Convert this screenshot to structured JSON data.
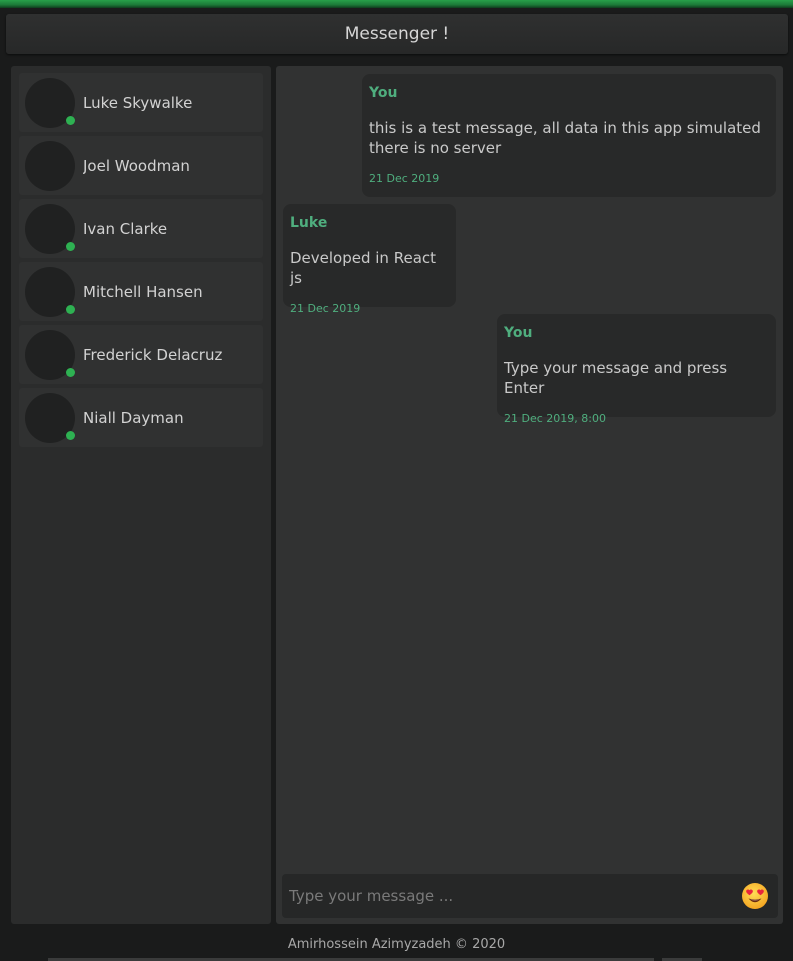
{
  "header": {
    "title": "Messenger !"
  },
  "contacts": [
    {
      "name": "Luke Skywalke",
      "online": true
    },
    {
      "name": "Joel Woodman",
      "online": false
    },
    {
      "name": "Ivan Clarke",
      "online": true
    },
    {
      "name": "Mitchell Hansen",
      "online": true
    },
    {
      "name": "Frederick Delacruz",
      "online": true
    },
    {
      "name": "Niall Dayman",
      "online": true
    }
  ],
  "messages": [
    {
      "author": "You",
      "text": "this is a test message, all data in this app simulated there is no server",
      "time": "21 Dec 2019"
    },
    {
      "author": "Luke",
      "text": "Developed in React js",
      "time": "21 Dec 2019"
    },
    {
      "author": "You",
      "text": "Type your message and press Enter",
      "time": "21 Dec 2019, 8:00"
    }
  ],
  "composer": {
    "placeholder": "Type your message ...",
    "value": ""
  },
  "footer": {
    "text": "Amirhossein Azimyzadeh © 2020"
  },
  "colors": {
    "accent": "#2eb152",
    "author": "#4fae7e"
  },
  "icons": {
    "emoji": "smiling-face-with-heart-eyes-icon"
  }
}
